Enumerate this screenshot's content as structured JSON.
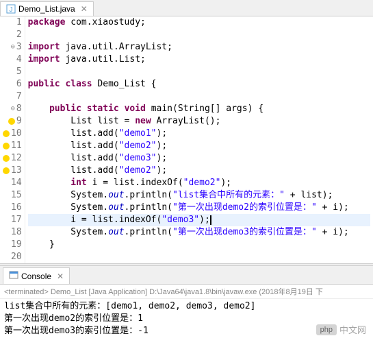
{
  "tab": {
    "title": "Demo_List.java"
  },
  "code": {
    "lines": [
      {
        "n": 1,
        "html": "<span class='kw'>package</span> com.xiaostudy;"
      },
      {
        "n": 2,
        "html": ""
      },
      {
        "n": 3,
        "marker": "fold",
        "html": "<span class='kw'>import</span> java.util.ArrayList;"
      },
      {
        "n": 4,
        "html": "<span class='kw'>import</span> java.util.List;"
      },
      {
        "n": 5,
        "html": ""
      },
      {
        "n": 6,
        "html": "<span class='kw'>public</span> <span class='kw'>class</span> Demo_List {"
      },
      {
        "n": 7,
        "html": ""
      },
      {
        "n": 8,
        "marker": "fold",
        "html": "    <span class='kw'>public</span> <span class='kw'>static</span> <span class='kw'>void</span> main(String[] args) {"
      },
      {
        "n": 9,
        "marker": "bulb",
        "html": "        List list = <span class='kw'>new</span> ArrayList();"
      },
      {
        "n": 10,
        "marker": "bulb",
        "html": "        list.add(<span class='str'>\"demo1\"</span>);"
      },
      {
        "n": 11,
        "marker": "bulb",
        "html": "        list.add(<span class='str'>\"demo2\"</span>);"
      },
      {
        "n": 12,
        "marker": "bulb",
        "html": "        list.add(<span class='str'>\"demo3\"</span>);"
      },
      {
        "n": 13,
        "marker": "bulb",
        "html": "        list.add(<span class='str'>\"demo2\"</span>);"
      },
      {
        "n": 14,
        "html": "        <span class='kw'>int</span> i = list.indexOf(<span class='str'>\"demo2\"</span>);"
      },
      {
        "n": 15,
        "html": "        System.<span class='field'>out</span>.println(<span class='str'>\"list集合中所有的元素：\"</span> + list);"
      },
      {
        "n": 16,
        "html": "        System.<span class='field'>out</span>.println(<span class='str'>\"第一次出现demo2的索引位置是：\"</span> + i);"
      },
      {
        "n": 17,
        "highlight": true,
        "html": "        i = list.indexOf(<span class='str'>\"demo3\"</span>);<span class='cursor'></span>"
      },
      {
        "n": 18,
        "html": "        System.<span class='field'>out</span>.println(<span class='str'>\"第一次出现demo3的索引位置是：\"</span> + i);"
      },
      {
        "n": 19,
        "html": "    }"
      },
      {
        "n": 20,
        "html": ""
      }
    ]
  },
  "console": {
    "tab_label": "Console",
    "header": "<terminated> Demo_List [Java Application] D:\\Java64\\java1.8\\bin\\javaw.exe (2018年8月19日 下",
    "output": [
      "list集合中所有的元素：[demo1, demo2, demo3, demo2]",
      "第一次出现demo2的索引位置是：1",
      "第一次出现demo3的索引位置是：-1"
    ]
  },
  "watermark": {
    "badge": "php",
    "text": "中文网"
  }
}
